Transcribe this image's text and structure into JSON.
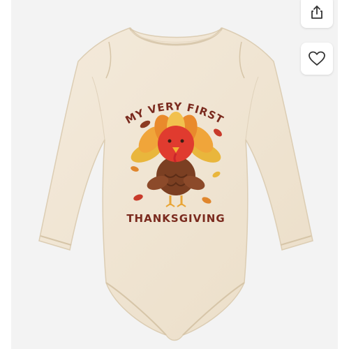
{
  "product_image": {
    "alt": "Baby long sleeve bodysuit with turkey graphic",
    "print_top": "MY VERY FIRST",
    "print_bottom": "THANKSGIVING"
  },
  "actions": {
    "share_icon": "share-icon",
    "favorite_icon": "heart-outline-icon"
  },
  "colors": {
    "garment": "#f1e6d3",
    "background": "#f3f3f3",
    "print_text": "#7a2a1e"
  }
}
